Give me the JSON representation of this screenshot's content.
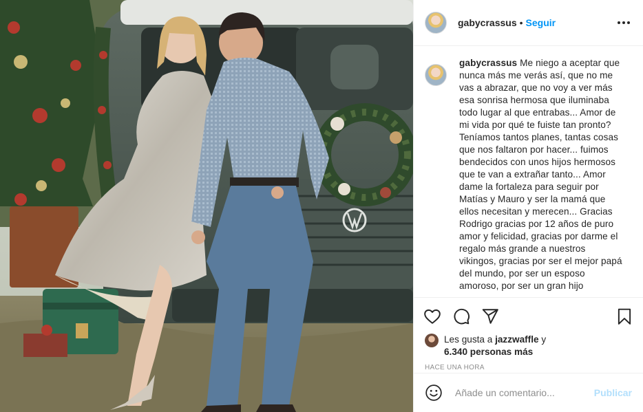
{
  "post": {
    "username": "gabycrassus",
    "dot": "•",
    "follow_label": "Seguir",
    "caption": {
      "username": "gabycrassus",
      "text": "Me niego a aceptar que nunca más me verás así, que no me vas a abrazar, que no voy a ver más esa sonrisa hermosa que iluminaba todo lugar al que entrabas... Amor de mi vida por qué te fuiste tan pronto? Teníamos tantos planes, tantas cosas que nos faltaron por hacer... fuimos bendecidos con unos hijos hermosos que te van a extrañar tanto... Amor dame la fortaleza para seguir por Matías y Mauro y ser la mamá que ellos necesitan y merecen... Gracias Rodrigo gracias por 12 años de puro amor y felicidad, gracias por darme el regalo más grande a nuestros vikingos, gracias por ser el mejor papá del mundo, por ser un esposo amoroso, por ser un gran hijo"
    },
    "likes": {
      "prefix": "Les gusta a",
      "user": "jazzwaffle",
      "conj": "y",
      "others": "6.340 personas más"
    },
    "timestamp": "HACE UNA HORA",
    "comment_placeholder": "Añade un comentario...",
    "publish_label": "Publicar"
  },
  "icons": {
    "more": "more-horizontal-icon",
    "like": "heart-icon",
    "comment": "comment-icon",
    "share": "paper-plane-icon",
    "save": "bookmark-icon",
    "emoji": "smiley-icon"
  },
  "colors": {
    "link_blue": "#0095f6",
    "publish_disabled": "#b2dffc",
    "secondary_text": "#8e8e8e",
    "divider": "#efefef"
  }
}
